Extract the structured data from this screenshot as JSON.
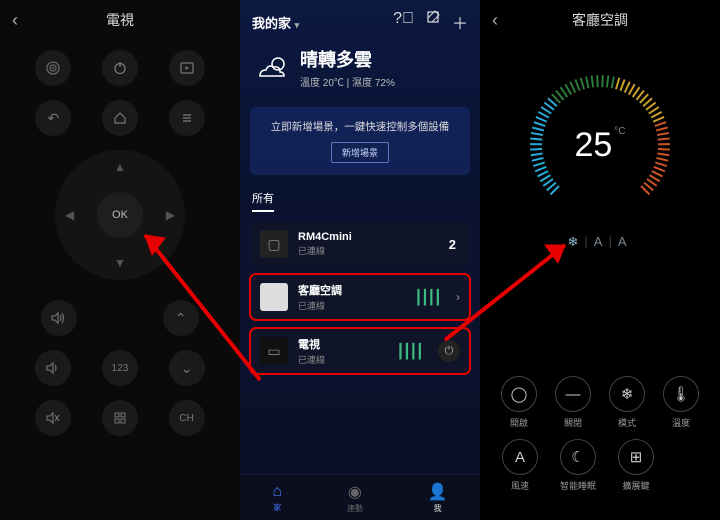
{
  "panel1": {
    "title": "電視",
    "ok_label": "OK",
    "btn_123": "123",
    "btn_ch": "CH"
  },
  "panel2": {
    "home_label": "我的家",
    "weather": {
      "main": "晴轉多雲",
      "sub": "溫度 20℃ | 濕度 72%"
    },
    "banner": {
      "text": "立即新增場景，一鍵快速控制多個設備",
      "button": "新增場景"
    },
    "tab_all": "所有",
    "devices": [
      {
        "name": "RM4Cmini",
        "status": "已連線",
        "count": "2"
      },
      {
        "name": "客廳空調",
        "status": "已連線"
      },
      {
        "name": "電視",
        "status": "已連線"
      }
    ],
    "tabbar": {
      "home": "家",
      "link": "連動",
      "me": "我"
    }
  },
  "panel3": {
    "title": "客廳空調",
    "temp_value": "25",
    "temp_unit": "°C",
    "modes": [
      "❄",
      "A",
      "A"
    ],
    "buttons": {
      "on": "開啟",
      "off": "關閉",
      "mode": "模式",
      "temp": "溫度",
      "fan": "風速",
      "sleep": "智能睡眠",
      "expand": "擴展鍵"
    }
  }
}
